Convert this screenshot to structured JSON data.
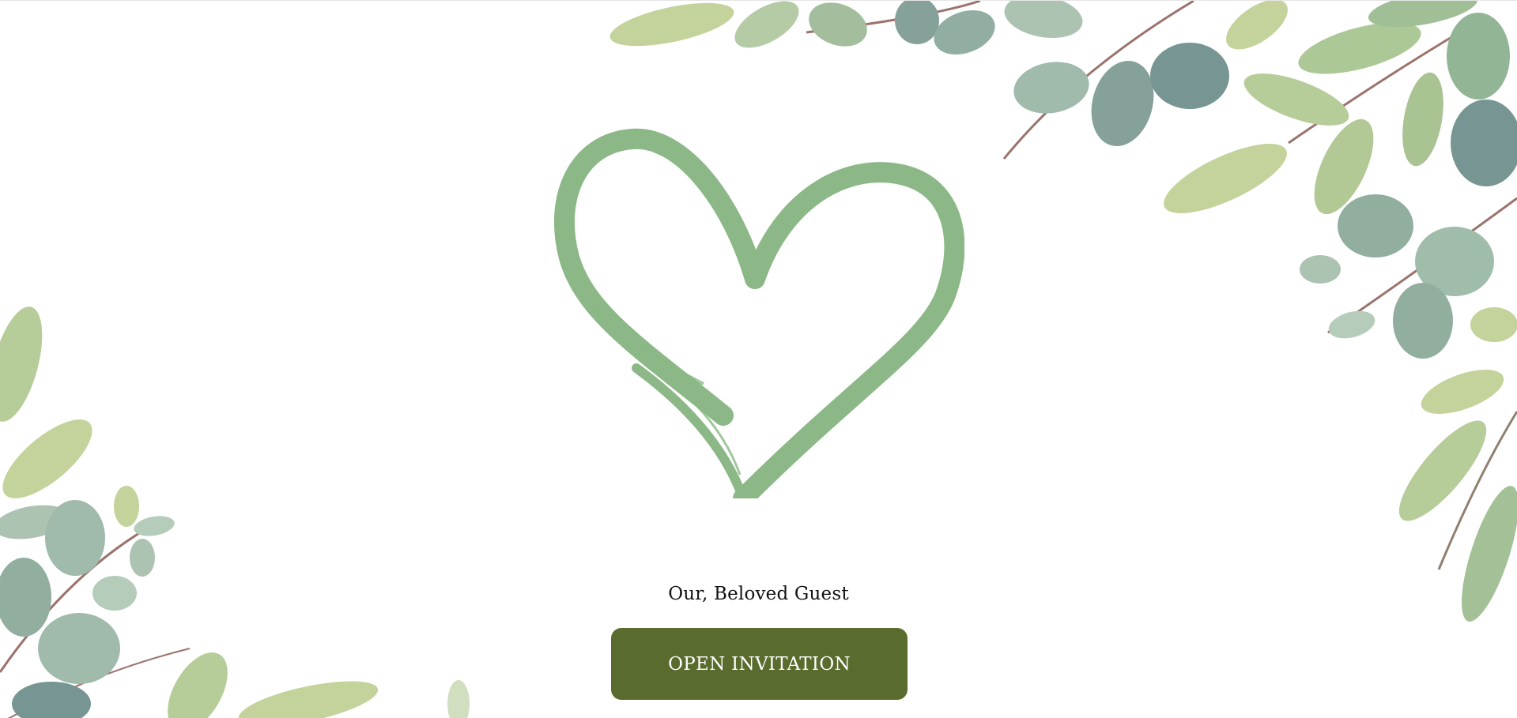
{
  "invitation": {
    "guest_label": "Our, Beloved Guest",
    "open_button_label": "OPEN INVITATION"
  },
  "icons": {
    "heart": "heart-icon",
    "decoration": "eucalyptus-leaves"
  },
  "colors": {
    "background": "#ffffff",
    "heart_stroke": "#8bb886",
    "button_background": "#5a6b2e",
    "button_text": "#ffffff",
    "leaf_light": "#b9cc8a",
    "leaf_mid": "#93b28c",
    "leaf_dark": "#6f9088",
    "stem": "#8a5a52"
  }
}
